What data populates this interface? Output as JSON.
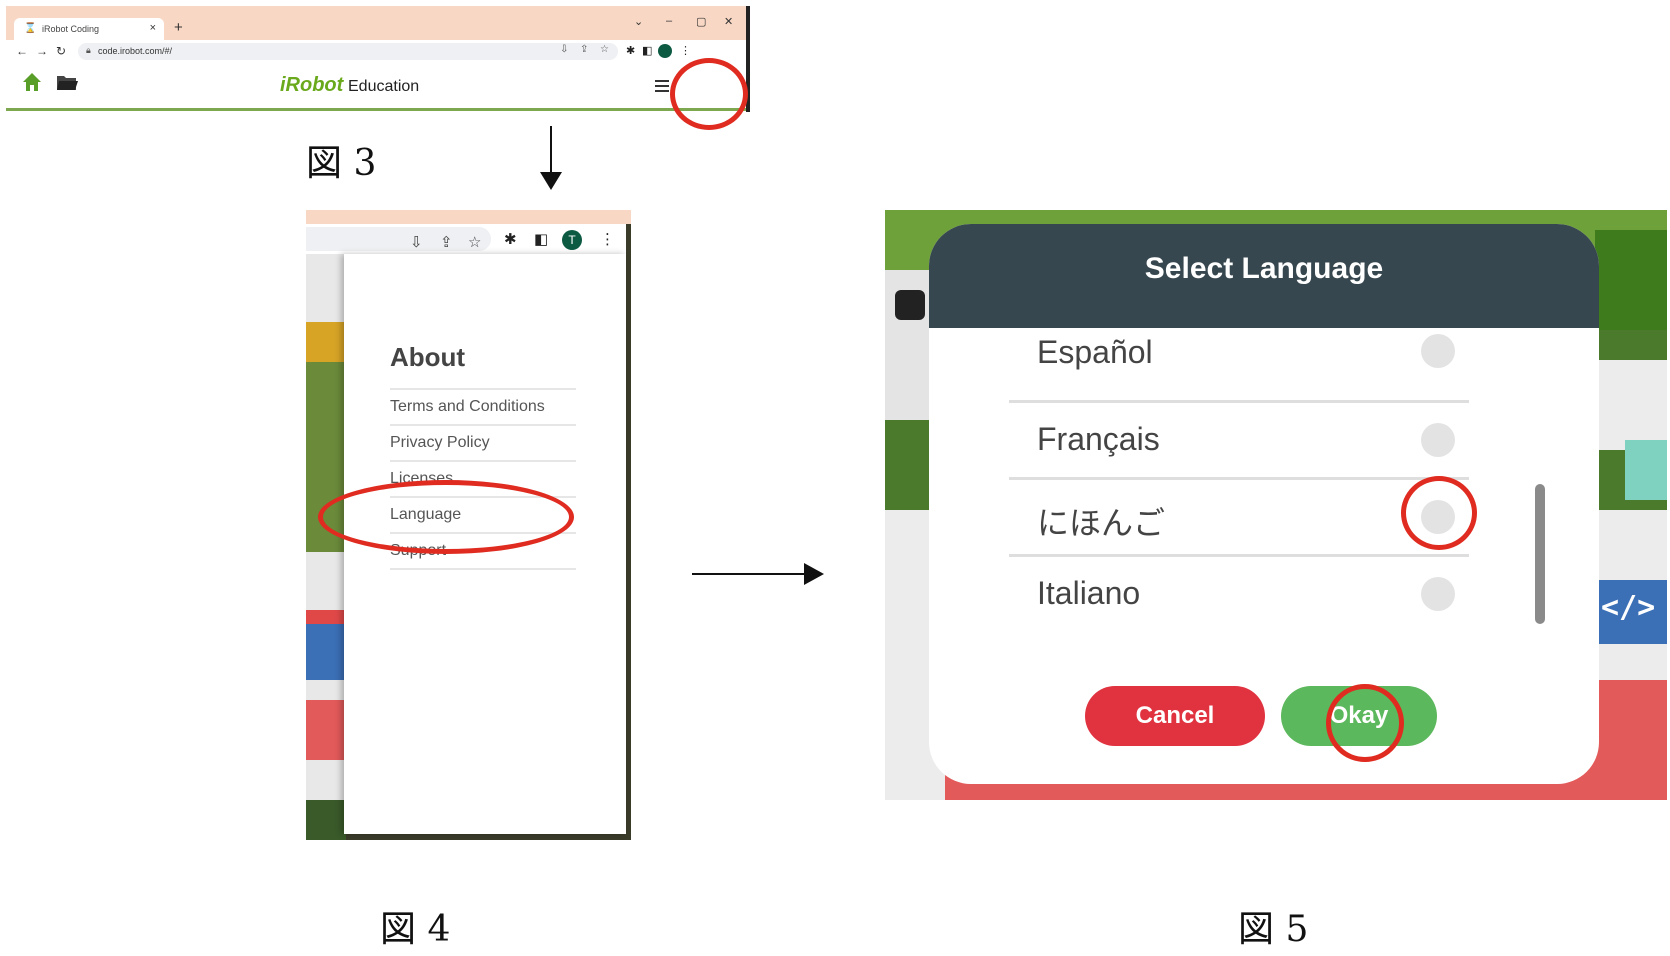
{
  "fig3": {
    "tab_title": "iRobot Coding",
    "tab_close": "×",
    "new_tab": "+",
    "window_controls": [
      "⌄",
      "–",
      "▢",
      "✕"
    ],
    "nav": [
      "←",
      "→",
      "↻"
    ],
    "url": "code.irobot.com/#/",
    "brand": "iRobot",
    "brand_sub": "Education",
    "icons": {
      "home": "home-icon",
      "folder": "folder-icon",
      "menu": "hamburger-menu-icon"
    }
  },
  "fig4": {
    "avatar_letter": "T",
    "menu_title": "About",
    "items": [
      "Terms and Conditions",
      "Privacy Policy",
      "Licenses",
      "Language",
      "Support"
    ]
  },
  "fig5": {
    "title": "Select Language",
    "languages": [
      "Español",
      "Français",
      "にほんご",
      "Italiano"
    ],
    "cancel": "Cancel",
    "okay": "Okay"
  },
  "captions": {
    "fig3": "図 3",
    "fig4": "図 4",
    "fig5": "図 5"
  },
  "colors": {
    "highlight": "#e02b20",
    "cancel": "#e0323f",
    "okay": "#5cb85c",
    "header": "#37474f",
    "brand": "#6aa81c"
  }
}
